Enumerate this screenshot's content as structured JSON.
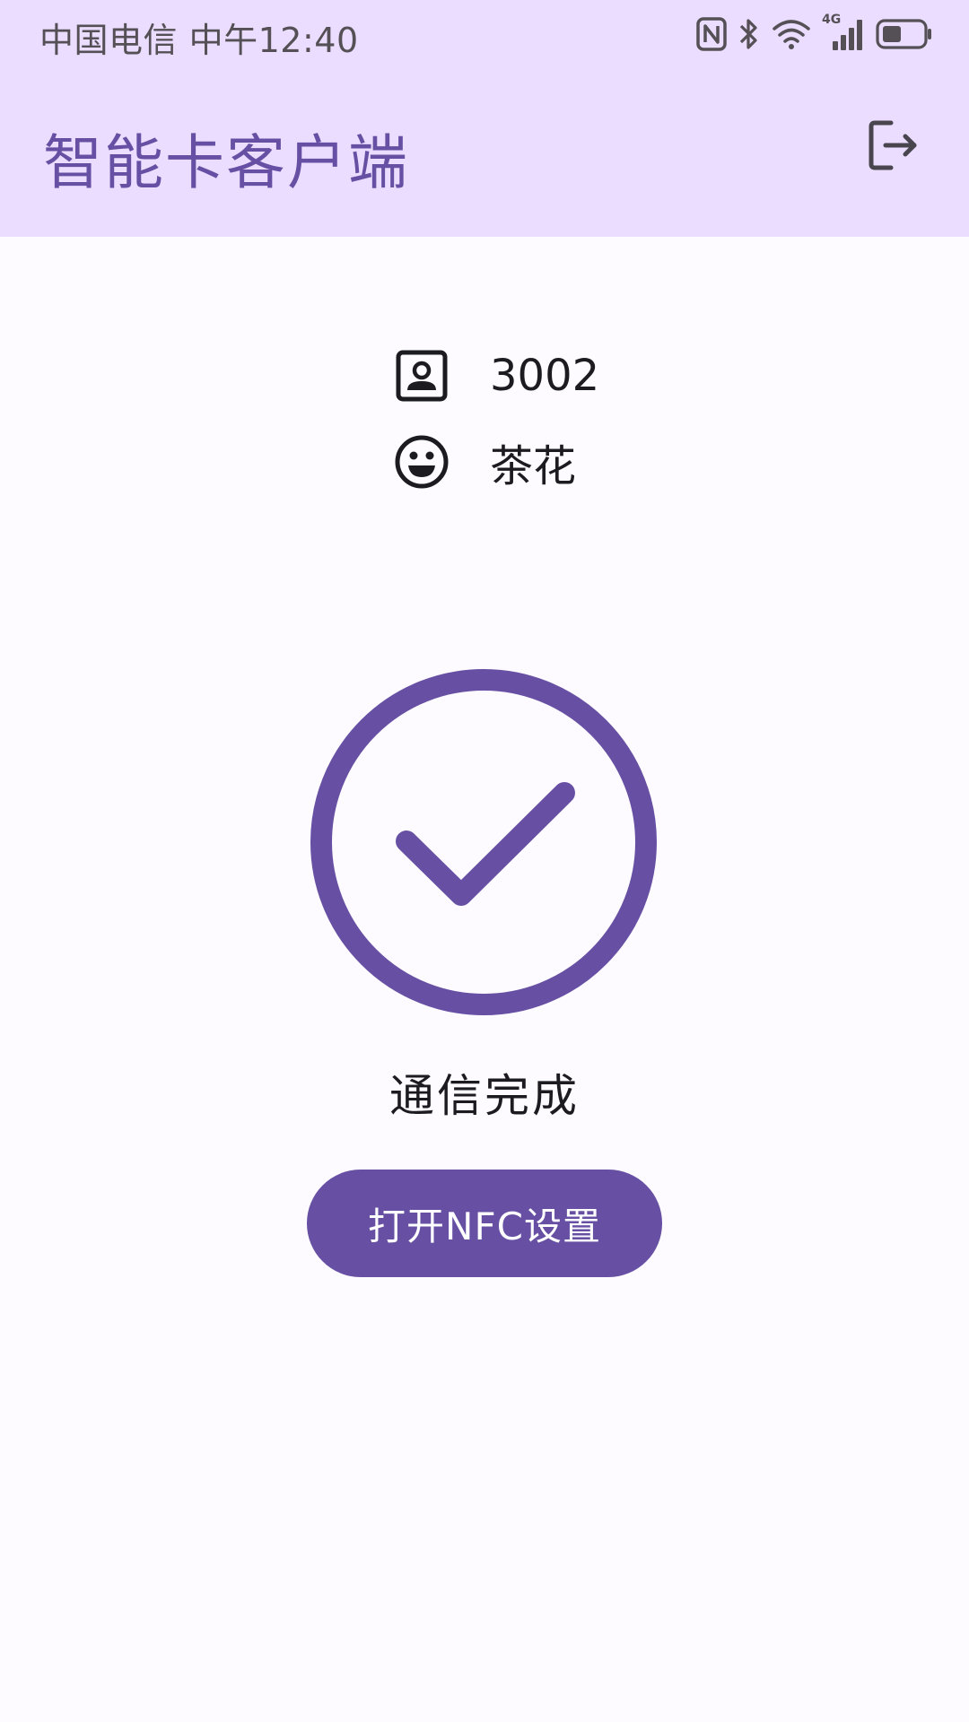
{
  "status_bar": {
    "carrier": "中国电信",
    "time": "中午12:40",
    "icons": [
      "nfc-icon",
      "bluetooth-icon",
      "wifi-icon",
      "4g-signal-icon",
      "battery-icon"
    ],
    "network_label": "4G"
  },
  "app_bar": {
    "title": "智能卡客户端",
    "logout_icon": "logout-icon"
  },
  "card_info": {
    "id_icon": "contact-card-icon",
    "id": "3002",
    "name_icon": "smiley-face-icon",
    "name": "茶花"
  },
  "result": {
    "icon": "check-circle-icon",
    "message": "通信完成"
  },
  "actions": {
    "open_nfc_settings": "打开NFC设置"
  },
  "colors": {
    "primary": "#6750A4",
    "top_bar_bg": "#EADDFF",
    "page_bg": "#FDFBFF",
    "text": "#1C1B1F"
  }
}
